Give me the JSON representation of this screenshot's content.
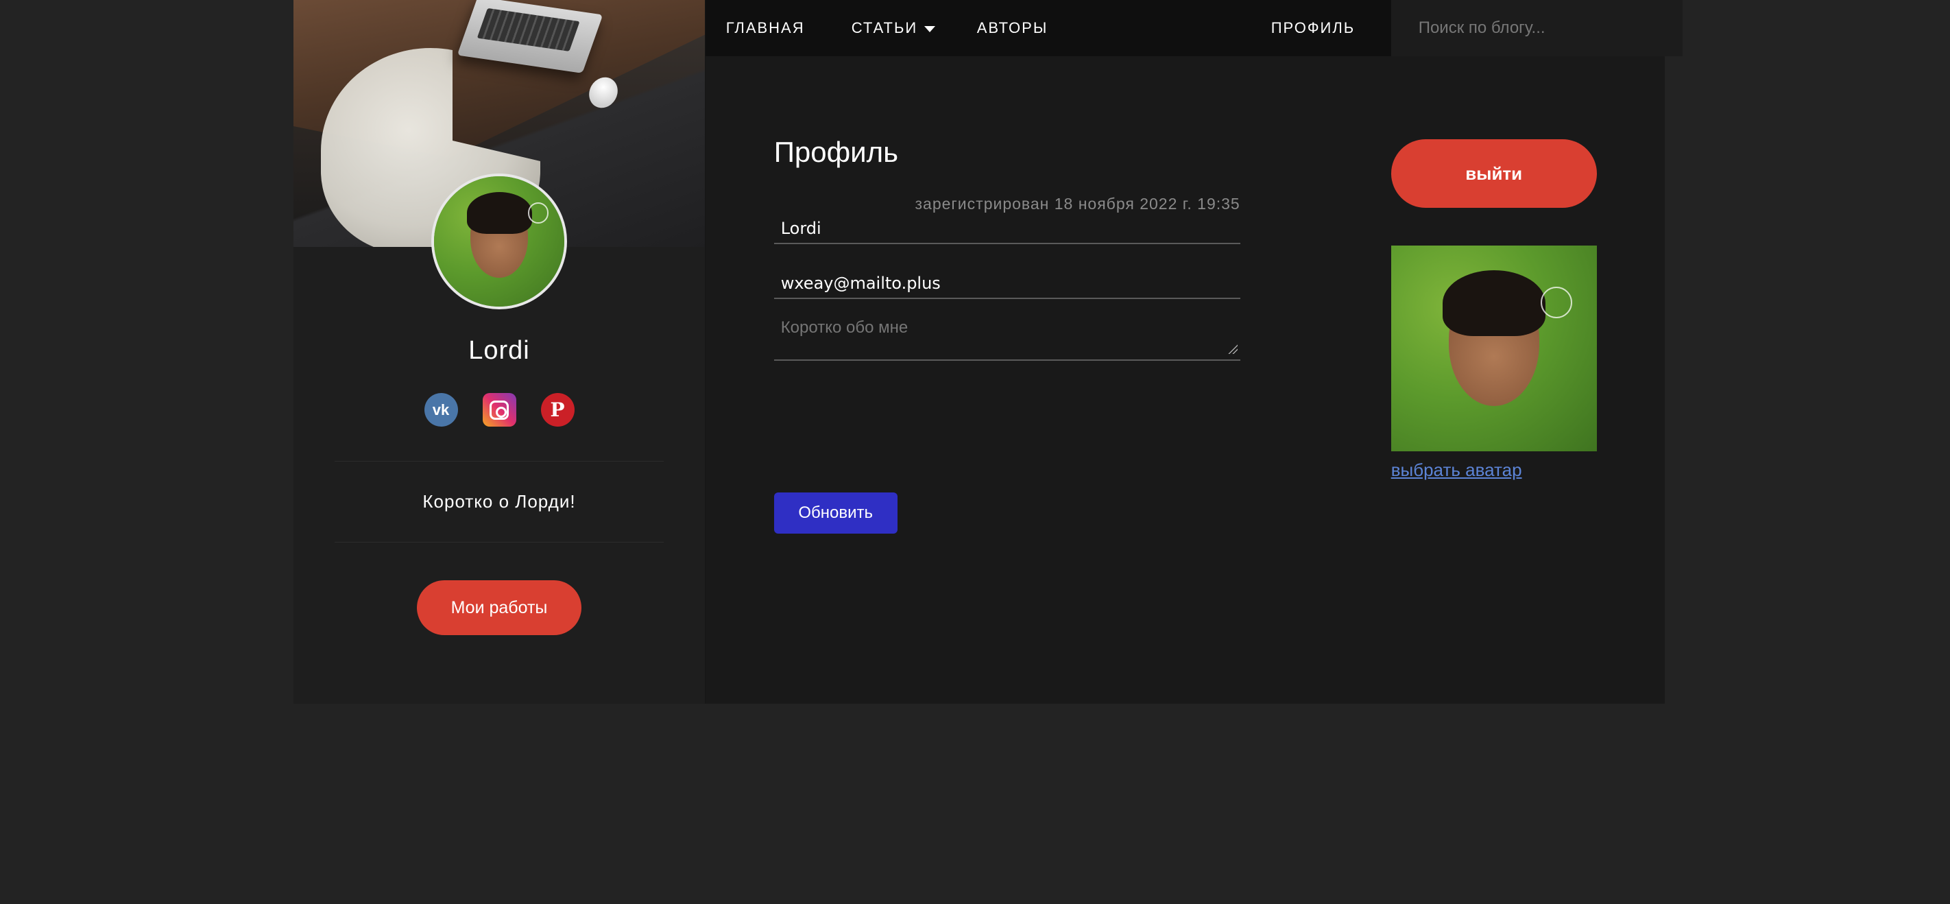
{
  "nav": {
    "home": "ГЛАВНАЯ",
    "articles": "СТАТЬИ",
    "authors": "АВТОРЫ",
    "profile": "ПРОФИЛЬ",
    "search_placeholder": "Поиск по блогу..."
  },
  "sidebar": {
    "username": "Lordi",
    "socials": [
      {
        "name": "vk-icon",
        "glyph": "vk"
      },
      {
        "name": "instagram-icon",
        "glyph": ""
      },
      {
        "name": "pinterest-icon",
        "glyph": "P"
      }
    ],
    "about": "Коротко о Лорди!",
    "works_button": "Мои работы"
  },
  "profile": {
    "title": "Профиль",
    "registered": "зарегистрирован 18 ноября 2022 г. 19:35",
    "username_value": "Lordi",
    "email_value": "wxeay@mailto.plus",
    "about_placeholder": "Коротко обо мне",
    "update_button": "Обновить",
    "logout_button": "выйти",
    "choose_avatar": "выбрать аватар"
  },
  "colors": {
    "accent_red": "#d93f31",
    "update_blue": "#2f2fc4",
    "link_blue": "#5c84d6",
    "background": "#232323"
  }
}
